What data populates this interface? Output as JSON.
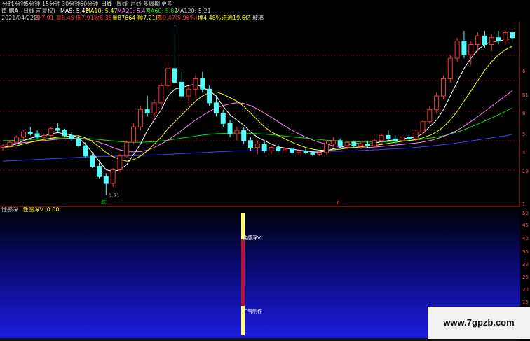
{
  "period_bar": {
    "items": [
      "分时",
      "1分钟",
      "5分钟",
      "15分钟",
      "30分钟",
      "60分钟",
      "日线",
      "周线",
      "月线",
      "多周期",
      "更多"
    ],
    "active": "日线"
  },
  "header": {
    "stock_name": "南 鹏A",
    "adjust": "(日线 前复权)",
    "ma5": "MA5: 5.43",
    "ma10": "MA10: 5.47",
    "ma20": "MA20: 5.47",
    "ma60": "MA60: 5.82",
    "ma120": "MA120: 5.21"
  },
  "quote": {
    "date": "2021/04/22四",
    "open": "开7.91",
    "high": "高8.45",
    "low": "低7.91",
    "close": "收8.35",
    "volume": "量87664",
    "amount": "额7.21亿",
    "change": "涨0.47(5.96%)",
    "turnover": "换4.48%",
    "float": "流通19.6亿",
    "extra": "玻璃"
  },
  "annotations": {
    "low_price": "3.71",
    "low_mark": "跌",
    "mid_mark": "B"
  },
  "indicator": {
    "name": "性感深",
    "value_label": "性感深V: 0.00",
    "bar_label_top": "性感深V",
    "bar_label_bottom": "牛气制作"
  },
  "price_axis": {
    "labels": [
      "6",
      "61",
      "6",
      "5",
      "4",
      "19",
      "1"
    ]
  },
  "indicator_axis": {
    "labels": [
      "50",
      "45",
      "40",
      "35",
      "30",
      "25",
      "20",
      "15",
      "10"
    ]
  },
  "watermark": "www.7gpzb.com",
  "colors": {
    "background": "#000000",
    "up": "#ff3232",
    "down": "#54fcfc",
    "ma5": "#ffffff",
    "ma10": "#ffff00",
    "ma20": "#ff80ff",
    "ma60": "#00e600",
    "ma120": "#4040ff",
    "grid": "#8b0000"
  },
  "chart_data": {
    "type": "candlestick",
    "price_range": [
      3.5,
      8.6
    ],
    "candles": [
      [
        5.1,
        5.2,
        5.0,
        5.15
      ],
      [
        5.15,
        5.3,
        5.1,
        5.25
      ],
      [
        5.25,
        5.45,
        5.2,
        5.4
      ],
      [
        5.4,
        5.6,
        5.3,
        5.55
      ],
      [
        5.55,
        5.7,
        5.45,
        5.5
      ],
      [
        5.5,
        5.6,
        5.35,
        5.4
      ],
      [
        5.4,
        5.5,
        5.3,
        5.45
      ],
      [
        5.45,
        5.7,
        5.4,
        5.65
      ],
      [
        5.65,
        5.8,
        5.55,
        5.6
      ],
      [
        5.6,
        5.65,
        5.4,
        5.45
      ],
      [
        5.45,
        5.55,
        5.3,
        5.35
      ],
      [
        5.35,
        5.45,
        5.1,
        5.15
      ],
      [
        5.15,
        5.25,
        4.8,
        4.85
      ],
      [
        4.85,
        4.95,
        4.5,
        4.55
      ],
      [
        4.55,
        4.65,
        4.2,
        4.25
      ],
      [
        4.25,
        4.35,
        3.71,
        4.05
      ],
      [
        4.05,
        4.5,
        3.95,
        4.45
      ],
      [
        4.45,
        4.9,
        4.4,
        4.85
      ],
      [
        4.85,
        5.3,
        4.8,
        5.25
      ],
      [
        5.25,
        5.8,
        5.2,
        5.7
      ],
      [
        5.7,
        6.3,
        5.6,
        6.2
      ],
      [
        6.2,
        6.6,
        6.0,
        6.1
      ],
      [
        6.1,
        6.5,
        5.9,
        6.4
      ],
      [
        6.4,
        7.0,
        6.3,
        6.9
      ],
      [
        6.9,
        7.6,
        6.8,
        7.4
      ],
      [
        7.4,
        8.6,
        7.2,
        7.0
      ],
      [
        7.0,
        7.3,
        6.5,
        6.6
      ],
      [
        6.6,
        6.9,
        6.3,
        6.8
      ],
      [
        6.8,
        7.2,
        6.6,
        7.1
      ],
      [
        7.1,
        7.3,
        6.7,
        6.8
      ],
      [
        6.8,
        6.9,
        6.3,
        6.4
      ],
      [
        6.4,
        6.6,
        6.0,
        6.1
      ],
      [
        6.1,
        6.2,
        5.7,
        5.8
      ],
      [
        5.8,
        5.9,
        5.4,
        5.5
      ],
      [
        5.5,
        5.7,
        5.3,
        5.6
      ],
      [
        5.6,
        5.7,
        5.2,
        5.3
      ],
      [
        5.3,
        5.4,
        5.0,
        5.1
      ],
      [
        5.1,
        5.3,
        4.9,
        5.2
      ],
      [
        5.2,
        5.3,
        4.95,
        5.0
      ],
      [
        5.0,
        5.15,
        4.9,
        5.1
      ],
      [
        5.1,
        5.2,
        4.95,
        5.0
      ],
      [
        5.0,
        5.1,
        4.9,
        5.05
      ],
      [
        5.05,
        5.1,
        4.9,
        4.95
      ],
      [
        4.95,
        5.05,
        4.85,
        5.0
      ],
      [
        5.0,
        5.1,
        4.9,
        4.95
      ],
      [
        4.95,
        5.0,
        4.85,
        4.9
      ],
      [
        4.9,
        5.0,
        4.85,
        4.95
      ],
      [
        4.95,
        5.3,
        4.9,
        5.2
      ],
      [
        5.2,
        5.4,
        5.1,
        5.3
      ],
      [
        5.3,
        5.35,
        5.1,
        5.15
      ],
      [
        5.15,
        5.3,
        5.05,
        5.25
      ],
      [
        5.25,
        5.3,
        5.1,
        5.15
      ],
      [
        5.15,
        5.25,
        5.05,
        5.2
      ],
      [
        5.2,
        5.3,
        5.1,
        5.15
      ],
      [
        5.15,
        5.35,
        5.1,
        5.3
      ],
      [
        5.3,
        5.5,
        5.2,
        5.45
      ],
      [
        5.45,
        5.6,
        5.3,
        5.35
      ],
      [
        5.35,
        5.45,
        5.2,
        5.3
      ],
      [
        5.3,
        5.45,
        5.25,
        5.4
      ],
      [
        5.4,
        5.5,
        5.3,
        5.35
      ],
      [
        5.35,
        5.6,
        5.3,
        5.55
      ],
      [
        5.55,
        5.9,
        5.5,
        5.85
      ],
      [
        5.85,
        6.3,
        5.8,
        6.2
      ],
      [
        6.2,
        6.7,
        6.1,
        6.6
      ],
      [
        6.6,
        7.2,
        6.5,
        7.1
      ],
      [
        7.1,
        7.8,
        7.0,
        7.7
      ],
      [
        7.7,
        8.3,
        7.6,
        8.2
      ],
      [
        8.2,
        8.5,
        7.7,
        7.8
      ],
      [
        7.8,
        8.2,
        7.5,
        8.1
      ],
      [
        8.1,
        8.45,
        7.9,
        8.35
      ],
      [
        8.35,
        8.5,
        8.0,
        8.1
      ],
      [
        8.1,
        8.4,
        7.9,
        8.3
      ],
      [
        8.3,
        8.5,
        8.1,
        8.2
      ],
      [
        8.2,
        8.5,
        8.1,
        8.45
      ],
      [
        8.45,
        8.5,
        8.2,
        8.3
      ]
    ],
    "ma_series": [
      {
        "name": "MA5",
        "values": [
          5.1,
          5.15,
          5.2,
          5.3,
          5.37,
          5.42,
          5.43,
          5.5,
          5.53,
          5.5,
          5.46,
          5.38,
          5.2,
          4.95,
          4.7,
          4.45,
          4.4,
          4.45,
          4.6,
          4.9,
          5.2,
          5.6,
          5.9,
          6.2,
          6.6,
          6.8,
          6.85,
          6.9,
          6.95,
          6.85,
          6.75,
          6.6,
          6.3,
          6.05,
          5.9,
          5.75,
          5.55,
          5.4,
          5.3,
          5.2,
          5.12,
          5.08,
          5.05,
          5.02,
          5.0,
          4.97,
          4.96,
          5.0,
          5.06,
          5.1,
          5.17,
          5.22,
          5.21,
          5.2,
          5.22,
          5.27,
          5.3,
          5.32,
          5.36,
          5.37,
          5.4,
          5.5,
          5.7,
          5.9,
          6.2,
          6.6,
          7.0,
          7.4,
          7.7,
          7.95,
          8.1,
          8.18,
          8.2,
          8.25,
          8.27
        ]
      },
      {
        "name": "MA10",
        "values": [
          5.1,
          5.12,
          5.15,
          5.2,
          5.25,
          5.3,
          5.33,
          5.37,
          5.4,
          5.42,
          5.44,
          5.44,
          5.38,
          5.27,
          5.12,
          4.95,
          4.83,
          4.75,
          4.7,
          4.75,
          4.85,
          5.0,
          5.2,
          5.4,
          5.65,
          5.85,
          6.05,
          6.25,
          6.45,
          6.6,
          6.7,
          6.72,
          6.65,
          6.55,
          6.45,
          6.3,
          6.1,
          5.9,
          5.7,
          5.55,
          5.45,
          5.35,
          5.25,
          5.17,
          5.1,
          5.05,
          5.02,
          5.02,
          5.03,
          5.05,
          5.08,
          5.1,
          5.12,
          5.14,
          5.16,
          5.19,
          5.22,
          5.25,
          5.28,
          5.3,
          5.33,
          5.38,
          5.45,
          5.55,
          5.7,
          5.9,
          6.15,
          6.45,
          6.75,
          7.05,
          7.35,
          7.6,
          7.8,
          7.95,
          8.05
        ]
      },
      {
        "name": "MA20",
        "values": [
          5.2,
          5.2,
          5.22,
          5.24,
          5.26,
          5.28,
          5.3,
          5.32,
          5.34,
          5.35,
          5.36,
          5.36,
          5.34,
          5.3,
          5.25,
          5.18,
          5.1,
          5.03,
          4.98,
          4.97,
          4.98,
          5.02,
          5.1,
          5.2,
          5.32,
          5.45,
          5.6,
          5.75,
          5.9,
          6.03,
          6.15,
          6.25,
          6.32,
          6.37,
          6.4,
          6.38,
          6.32,
          6.22,
          6.1,
          5.98,
          5.85,
          5.72,
          5.6,
          5.5,
          5.4,
          5.32,
          5.25,
          5.2,
          5.15,
          5.12,
          5.1,
          5.09,
          5.09,
          5.1,
          5.11,
          5.13,
          5.15,
          5.17,
          5.19,
          5.21,
          5.23,
          5.26,
          5.3,
          5.35,
          5.42,
          5.5,
          5.6,
          5.72,
          5.86,
          6.0,
          6.15,
          6.3,
          6.45,
          6.6,
          6.75
        ]
      },
      {
        "name": "MA60",
        "values": [
          5.3,
          5.3,
          5.31,
          5.32,
          5.33,
          5.34,
          5.35,
          5.36,
          5.37,
          5.37,
          5.37,
          5.37,
          5.36,
          5.35,
          5.33,
          5.31,
          5.29,
          5.27,
          5.26,
          5.25,
          5.25,
          5.26,
          5.27,
          5.29,
          5.31,
          5.34,
          5.37,
          5.4,
          5.43,
          5.46,
          5.48,
          5.5,
          5.51,
          5.52,
          5.52,
          5.52,
          5.51,
          5.5,
          5.49,
          5.47,
          5.45,
          5.43,
          5.41,
          5.39,
          5.37,
          5.35,
          5.33,
          5.31,
          5.3,
          5.29,
          5.28,
          5.27,
          5.26,
          5.26,
          5.26,
          5.26,
          5.27,
          5.28,
          5.29,
          5.3,
          5.32,
          5.34,
          5.37,
          5.4,
          5.44,
          5.49,
          5.55,
          5.62,
          5.7,
          5.78,
          5.87,
          5.96,
          6.05,
          6.15,
          6.25
        ]
      },
      {
        "name": "MA120",
        "values": [
          4.7,
          4.71,
          4.72,
          4.73,
          4.74,
          4.75,
          4.76,
          4.77,
          4.78,
          4.79,
          4.8,
          4.81,
          4.82,
          4.83,
          4.84,
          4.84,
          4.84,
          4.85,
          4.85,
          4.86,
          4.86,
          4.87,
          4.88,
          4.89,
          4.9,
          4.91,
          4.92,
          4.93,
          4.94,
          4.95,
          4.96,
          4.97,
          4.98,
          4.99,
          5.0,
          5.0,
          5.0,
          5.0,
          5.0,
          5.0,
          5.0,
          5.0,
          5.0,
          5.0,
          4.99,
          4.99,
          4.99,
          4.99,
          4.99,
          4.99,
          5.0,
          5.0,
          5.01,
          5.02,
          5.03,
          5.04,
          5.05,
          5.06,
          5.07,
          5.08,
          5.1,
          5.12,
          5.14,
          5.16,
          5.18,
          5.2,
          5.23,
          5.26,
          5.29,
          5.32,
          5.35,
          5.38,
          5.41,
          5.44,
          5.48
        ]
      }
    ]
  }
}
